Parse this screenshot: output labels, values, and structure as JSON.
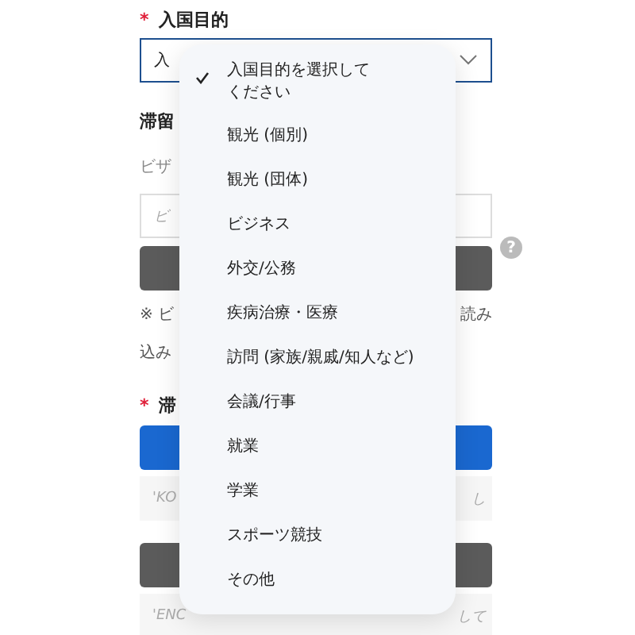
{
  "purpose_field": {
    "required_mark": "*",
    "label": "入国目的",
    "value": "入"
  },
  "stay_label": "滞留",
  "visa_label": "ビザ",
  "visa_input": {
    "placeholder": "ビ"
  },
  "help_icon": "?",
  "note": {
    "left": "※ ビ",
    "right": "読み",
    "second_line": "込み"
  },
  "stay_field": {
    "required_mark": "*",
    "label": "滞"
  },
  "row_1": {
    "left": "'KO",
    "right": "し"
  },
  "row_2": {
    "left": "'ENC",
    "right": "して"
  },
  "dropdown": {
    "items": [
      {
        "label": "入国目的を選択してください",
        "selected": true
      },
      {
        "label": "観光 (個別)",
        "selected": false
      },
      {
        "label": "観光 (団体)",
        "selected": false
      },
      {
        "label": "ビジネス",
        "selected": false
      },
      {
        "label": "外交/公務",
        "selected": false
      },
      {
        "label": "疾病治療・医療",
        "selected": false
      },
      {
        "label": "訪問 (家族/親戚/知人など)",
        "selected": false
      },
      {
        "label": "会議/行事",
        "selected": false
      },
      {
        "label": "就業",
        "selected": false
      },
      {
        "label": "学業",
        "selected": false
      },
      {
        "label": "スポーツ競技",
        "selected": false
      },
      {
        "label": "その他",
        "selected": false
      }
    ]
  }
}
